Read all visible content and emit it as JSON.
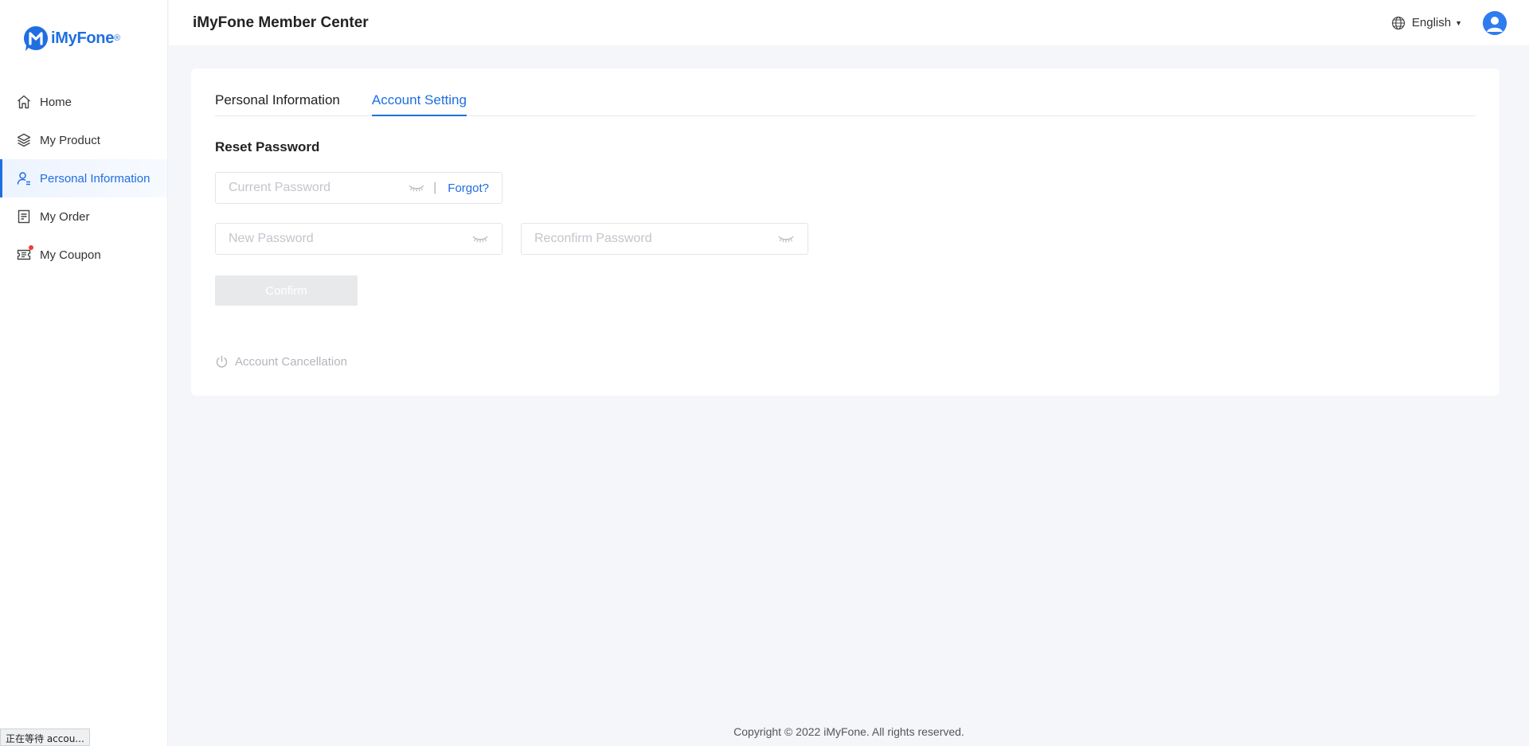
{
  "brand": {
    "name": "iMyFone",
    "reg_mark": "®",
    "color": "#1f6fe0"
  },
  "sidebar": {
    "items": [
      {
        "label": "Home",
        "icon": "home-icon",
        "active": false
      },
      {
        "label": "My Product",
        "icon": "layers-icon",
        "active": false
      },
      {
        "label": "Personal Information",
        "icon": "user-icon",
        "active": true
      },
      {
        "label": "My Order",
        "icon": "order-icon",
        "active": false
      },
      {
        "label": "My Coupon",
        "icon": "coupon-icon",
        "active": false,
        "badge": true
      }
    ]
  },
  "header": {
    "title": "iMyFone Member Center",
    "language": "English",
    "language_icon": "globe-icon",
    "avatar_icon": "avatar-icon"
  },
  "tabs": [
    {
      "label": "Personal Information",
      "active": false
    },
    {
      "label": "Account Setting",
      "active": true
    }
  ],
  "reset_password": {
    "title": "Reset Password",
    "current_password": {
      "placeholder": "Current Password",
      "value": ""
    },
    "forgot_label": "Forgot?",
    "separator": "|",
    "new_password": {
      "placeholder": "New Password",
      "value": ""
    },
    "reconfirm_password": {
      "placeholder": "Reconfirm Password",
      "value": ""
    },
    "confirm_label": "Confirm"
  },
  "account_cancellation": {
    "label": "Account Cancellation",
    "icon": "power-icon"
  },
  "footer": {
    "copyright": "Copyright © 2022 iMyFone. All rights reserved."
  },
  "status_bar": {
    "text": "正在等待 accou..."
  }
}
